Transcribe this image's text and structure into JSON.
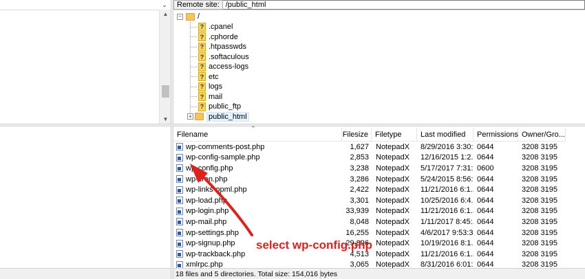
{
  "local": {
    "dropdown_icon": "chevron-down-icon"
  },
  "remote_bar": {
    "label": "Remote site:",
    "path": "/public_html"
  },
  "tree": {
    "root": "/",
    "items": [
      {
        "label": ".cpanel",
        "icon": "question-folder-icon"
      },
      {
        "label": ".cphorde",
        "icon": "question-folder-icon"
      },
      {
        "label": ".htpasswds",
        "icon": "question-folder-icon"
      },
      {
        "label": ".softaculous",
        "icon": "question-folder-icon"
      },
      {
        "label": "access-logs",
        "icon": "question-folder-icon"
      },
      {
        "label": "etc",
        "icon": "question-folder-icon"
      },
      {
        "label": "logs",
        "icon": "question-folder-icon"
      },
      {
        "label": "mail",
        "icon": "question-folder-icon"
      },
      {
        "label": "public_ftp",
        "icon": "question-folder-icon"
      },
      {
        "label": "public_html",
        "icon": "folder-icon",
        "selected": true
      }
    ]
  },
  "filelist": {
    "columns": [
      "Filename",
      "Filesize",
      "Filetype",
      "Last modified",
      "Permissions",
      "Owner/Gro..."
    ],
    "rows": [
      {
        "name": "wp-comments-post.php",
        "size": "1,627",
        "type": "NotepadX",
        "modified": "8/29/2016 3:30:...",
        "perm": "0644",
        "owner": "3208 3195"
      },
      {
        "name": "wp-config-sample.php",
        "size": "2,853",
        "type": "NotepadX",
        "modified": "12/16/2015 1:2...",
        "perm": "0644",
        "owner": "3208 3195"
      },
      {
        "name": "wp-config.php",
        "size": "3,238",
        "type": "NotepadX",
        "modified": "5/17/2017 7:31:...",
        "perm": "0600",
        "owner": "3208 3195"
      },
      {
        "name": "wp-cron.php",
        "size": "3,286",
        "type": "NotepadX",
        "modified": "5/24/2015 8:56:...",
        "perm": "0644",
        "owner": "3208 3195"
      },
      {
        "name": "wp-links-opml.php",
        "size": "2,422",
        "type": "NotepadX",
        "modified": "11/21/2016 6:1...",
        "perm": "0644",
        "owner": "3208 3195"
      },
      {
        "name": "wp-load.php",
        "size": "3,301",
        "type": "NotepadX",
        "modified": "10/25/2016 6:4...",
        "perm": "0644",
        "owner": "3208 3195"
      },
      {
        "name": "wp-login.php",
        "size": "33,939",
        "type": "NotepadX",
        "modified": "11/21/2016 6:1...",
        "perm": "0644",
        "owner": "3208 3195"
      },
      {
        "name": "wp-mail.php",
        "size": "8,048",
        "type": "NotepadX",
        "modified": "1/11/2017 8:45:...",
        "perm": "0644",
        "owner": "3208 3195"
      },
      {
        "name": "wp-settings.php",
        "size": "16,255",
        "type": "NotepadX",
        "modified": "4/6/2017 9:53:3...",
        "perm": "0644",
        "owner": "3208 3195"
      },
      {
        "name": "wp-signup.php",
        "size": "29,896",
        "type": "NotepadX",
        "modified": "10/19/2016 8:1...",
        "perm": "0644",
        "owner": "3208 3195"
      },
      {
        "name": "wp-trackback.php",
        "size": "4,513",
        "type": "NotepadX",
        "modified": "11/21/2016 6:1...",
        "perm": "0644",
        "owner": "3208 3195"
      },
      {
        "name": "xmlrpc.php",
        "size": "3,065",
        "type": "NotepadX",
        "modified": "8/31/2016 6:01:...",
        "perm": "0644",
        "owner": "3208 3195"
      }
    ]
  },
  "status": {
    "text": "18 files and 5 directories. Total size: 154,016 bytes"
  },
  "annotation": {
    "text": "select wp-config.php",
    "color": "#e0201b"
  }
}
